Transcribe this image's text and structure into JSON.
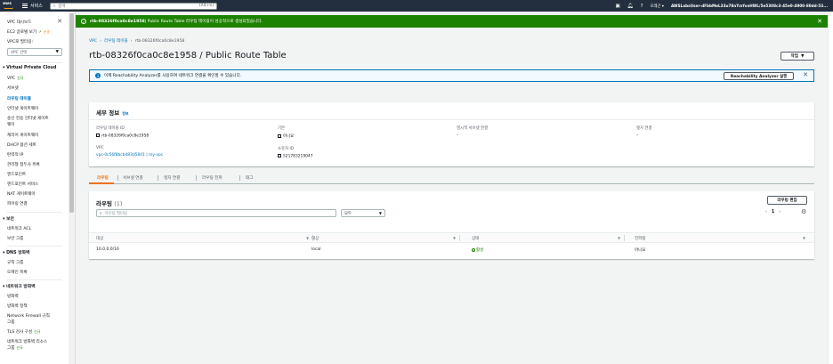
{
  "topnav": {
    "logo": "aws",
    "services_label": "서비스",
    "search_placeholder": "검색",
    "search_shortcut": "[Alt+S]",
    "region": "오레곤 ▾",
    "account": "AWSLabsUser-dFbbMeL33u78nYzrfvoHWL/5e5308c3-45e0-4900-80dd-53..."
  },
  "sidebar": {
    "title": "VPC 대시보드",
    "global_view": "EC2 글로벌 보기",
    "global_view_badge": "신규",
    "filter_label": "VPC로 필터링:",
    "filter_value": "VPC 선택",
    "section_vpc": "Virtual Private Cloud",
    "items": [
      {
        "label": "VPC",
        "badge": "신규"
      },
      {
        "label": "서브넷"
      },
      {
        "label": "라우팅 테이블"
      },
      {
        "label": "인터넷 게이트웨이"
      },
      {
        "label": "송신 전용 인터넷 게이트"
      },
      {
        "label": "웨이"
      },
      {
        "label": "캐리어 게이트웨이"
      },
      {
        "label": "DHCP 옵션 세트"
      },
      {
        "label": "탄력적 IP"
      },
      {
        "label": "관리형 접두사 목록"
      },
      {
        "label": "엔드포인트"
      },
      {
        "label": "엔드포인트 서비스"
      },
      {
        "label": "NAT 게이트웨이"
      },
      {
        "label": "피어링 연결"
      }
    ],
    "section_security": "보안",
    "security_items": [
      {
        "label": "네트워크 ACL"
      },
      {
        "label": "보안 그룹"
      }
    ],
    "section_dns": "DNS 방화벽",
    "dns_items": [
      {
        "label": "규칙 그룹"
      },
      {
        "label": "도메인 목록"
      }
    ],
    "section_netfw": "네트워크 방화벽",
    "netfw_items": [
      {
        "label": "방화벽"
      },
      {
        "label": "방화벽 정책"
      },
      {
        "label": "Network Firewall 규칙"
      },
      {
        "label": "그룹"
      },
      {
        "label": "TLS 검사 구성",
        "badge": "신규"
      },
      {
        "label": "네트워크 방화벽 리소스"
      },
      {
        "label": "그룹",
        "badge": "신규"
      }
    ]
  },
  "flash": {
    "route_table_id": "rtb-08326f0ca0c8e1958",
    "message": " | Public Route Table 라우팅 테이블이 성공적으로 생성되었습니다."
  },
  "breadcrumb": {
    "vpc": "VPC",
    "route_tables": "라우팅 테이블",
    "current": "rtb-08326f0ca0c8e1958"
  },
  "page_title": "rtb-08326f0ca0c8e1958 / Public Route Table",
  "actions_label": "작업",
  "info_banner": {
    "text": "이제 Reachability Analyzer를 사용하여 네트워크 연결을 확인할 수 있습니다.",
    "button": "Reachability Analyzer 실행"
  },
  "details": {
    "title": "세부 정보",
    "info": "정보",
    "route_table_id_label": "라우팅 테이블 ID",
    "route_table_id": "rtb-08326f0ca0c8e1958",
    "main_label": "기본",
    "main_value": "아니요",
    "explicit_subnet_label": "명시적 서브넷 연결",
    "explicit_subnet_value": "–",
    "edge_label": "엣지 연결",
    "edge_value": "–",
    "vpc_label": "VPC",
    "vpc_value": "vpc-0c56f8bcb483d5841 | my-vpc",
    "owner_label": "소유자 ID",
    "owner_value": "521783219047"
  },
  "tabs": [
    {
      "label": "라우팅"
    },
    {
      "label": "서브넷 연결"
    },
    {
      "label": "엣지 연결"
    },
    {
      "label": "라우팅 전파"
    },
    {
      "label": "태그"
    }
  ],
  "routes": {
    "title": "라우팅",
    "count": "(1)",
    "edit_button": "라우팅 편집",
    "filter_placeholder": "라우팅 필터링",
    "filter_select": "모두",
    "page": "1",
    "columns": [
      "대상",
      "대상",
      "상태",
      "전파됨"
    ],
    "rows": [
      {
        "destination": "10.0.0.0/16",
        "target": "local",
        "status": "활성",
        "propagated": "아니요"
      }
    ]
  }
}
